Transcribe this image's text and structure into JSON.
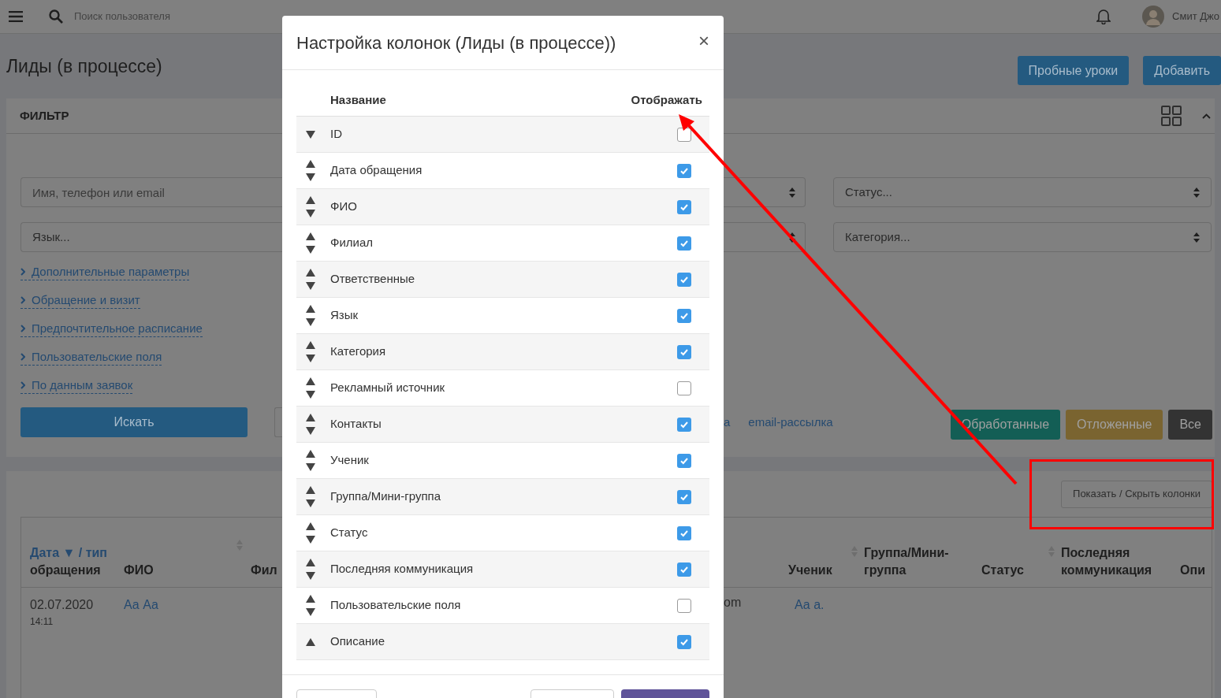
{
  "topbar": {
    "search_placeholder": "Поиск пользователя",
    "user_name": "Смит Джо"
  },
  "page": {
    "title": "Лиды (в процессе)",
    "actions": [
      "Пробные уроки",
      "Добавить"
    ]
  },
  "filter": {
    "title": "ФИЛЬТР",
    "expanded": true,
    "left_fields": [
      {
        "kind": "input",
        "placeholder": "Имя, телефон или email"
      },
      {
        "kind": "select",
        "text": "Язык..."
      }
    ],
    "right_fields": [
      "Статус...",
      "Категория..."
    ],
    "sections": [
      "Дополнительные параметры",
      "Обращение и визит",
      "Предпочтительное расписание",
      "Пользовательские поля",
      "По данным заявок"
    ],
    "search_button": "Искать",
    "tags": [
      "а",
      "email-рассылка"
    ],
    "status_buttons": [
      {
        "label": "Обработанные",
        "color": "#135e55"
      },
      {
        "label": "Отложенные",
        "color": "#7a6430"
      },
      {
        "label": "Все",
        "color": "#333333"
      }
    ]
  },
  "table": {
    "toggle_button": "Показать / Скрыть колонки",
    "left_columns": [
      {
        "link": "Дата ▼ / тип",
        "text": "обращения"
      },
      {
        "text": "ФИО",
        "sortable": true
      },
      {
        "text": "Фил"
      }
    ],
    "right_columns": [
      {
        "text": "Ученик",
        "sortable": true
      },
      {
        "text": "Группа/Мини-группа"
      },
      {
        "text": "Статус",
        "sortable": true
      },
      {
        "text": "Последняя коммуникация"
      },
      {
        "text": "Опи"
      }
    ],
    "row": {
      "date": "02.07.2020",
      "time": "14:11",
      "name": "Аа Аа",
      "column_hidden": "om",
      "student": "Аа а."
    }
  },
  "modal": {
    "title": "Настройка колонок (Лиды (в процессе))",
    "close": "×",
    "header_name": "Название",
    "header_show": "Отображать",
    "columns": [
      {
        "name": "ID",
        "can_move_up": false,
        "can_move_down": true,
        "checked": false
      },
      {
        "name": "Дата обращения",
        "can_move_up": true,
        "can_move_down": true,
        "checked": true
      },
      {
        "name": "ФИО",
        "can_move_up": true,
        "can_move_down": true,
        "checked": true
      },
      {
        "name": "Филиал",
        "can_move_up": true,
        "can_move_down": true,
        "checked": true
      },
      {
        "name": "Ответственные",
        "can_move_up": true,
        "can_move_down": true,
        "checked": true
      },
      {
        "name": "Язык",
        "can_move_up": true,
        "can_move_down": true,
        "checked": true
      },
      {
        "name": "Категория",
        "can_move_up": true,
        "can_move_down": true,
        "checked": true
      },
      {
        "name": "Рекламный источник",
        "can_move_up": true,
        "can_move_down": true,
        "checked": false
      },
      {
        "name": "Контакты",
        "can_move_up": true,
        "can_move_down": true,
        "checked": true
      },
      {
        "name": "Ученик",
        "can_move_up": true,
        "can_move_down": true,
        "checked": true
      },
      {
        "name": "Группа/Мини-группа",
        "can_move_up": true,
        "can_move_down": true,
        "checked": true
      },
      {
        "name": "Статус",
        "can_move_up": true,
        "can_move_down": true,
        "checked": true
      },
      {
        "name": "Последняя коммуникация",
        "can_move_up": true,
        "can_move_down": true,
        "checked": true
      },
      {
        "name": "Пользовательские поля",
        "can_move_up": true,
        "can_move_down": true,
        "checked": false
      },
      {
        "name": "Описание",
        "can_move_up": true,
        "can_move_down": false,
        "checked": true
      }
    ]
  }
}
